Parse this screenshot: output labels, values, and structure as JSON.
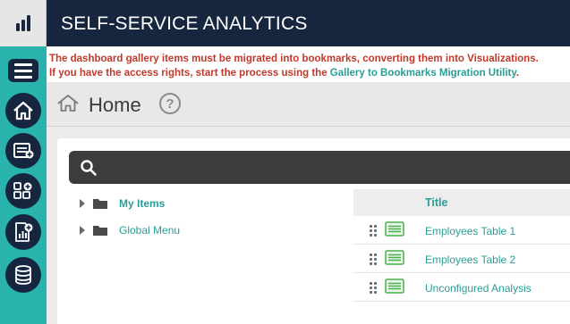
{
  "app": {
    "title": "SELF-SERVICE ANALYTICS"
  },
  "icons": {
    "logo": "bar-chart-logo-icon",
    "menu": "hamburger-menu-icon",
    "sidebar": [
      "home-icon",
      "add-list-report-icon",
      "add-dashboard-icon",
      "add-chart-document-icon",
      "database-icon"
    ],
    "header": [
      "home-outline-icon",
      "help-icon"
    ],
    "search": "search-icon",
    "tree": "folder-icon",
    "row": [
      "drag-handle-icon",
      "table-report-icon"
    ]
  },
  "warning": {
    "line1": "The dashboard gallery items must be migrated into bookmarks, converting them into Visualizations.",
    "line2_prefix": "If you have the access rights, start the process using the ",
    "link": "Gallery to Bookmarks Migration Utility",
    "line2_suffix": "."
  },
  "header": {
    "title": "Home",
    "help": "?"
  },
  "tree": {
    "items": [
      {
        "label": "My Items"
      },
      {
        "label": "Global Menu"
      }
    ]
  },
  "list": {
    "column_title": "Title",
    "rows": [
      {
        "title": "Employees Table 1"
      },
      {
        "title": "Employees Table 2"
      },
      {
        "title": "Unconfigured Analysis"
      }
    ]
  },
  "colors": {
    "topbar": "#17263f",
    "sidebar": "#2ab3ac",
    "accent": "#2a9d97",
    "warning": "#c0392b",
    "search_bg": "#3c3c3c"
  }
}
